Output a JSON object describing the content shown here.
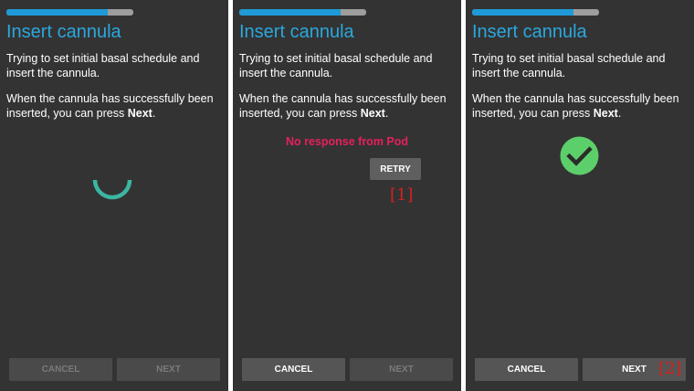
{
  "panels": [
    {
      "progress": 0.8,
      "title": "Insert cannula",
      "description": "Trying to set initial basal schedule and insert the cannula.",
      "hint_prefix": "When the cannula has successfully been inserted, you can press ",
      "hint_bold": "Next",
      "hint_suffix": ".",
      "status_icon": "loading-spinner",
      "cancel_label": "CANCEL",
      "next_label": "NEXT"
    },
    {
      "progress": 0.8,
      "title": "Insert cannula",
      "description": "Trying to set initial basal schedule and insert the cannula.",
      "hint_prefix": "When the cannula has successfully been inserted, you can press ",
      "hint_bold": "Next",
      "hint_suffix": ".",
      "error_text": "No response from Pod",
      "retry_label": "RETRY",
      "marker": "[1]",
      "cancel_label": "CANCEL",
      "next_label": "NEXT"
    },
    {
      "progress": 0.8,
      "title": "Insert cannula",
      "description": "Trying to set initial basal schedule and insert the cannula.",
      "hint_prefix": "When the cannula has successfully been inserted, you can press ",
      "hint_bold": "Next",
      "hint_suffix": ".",
      "status_icon": "check-circle",
      "marker": "[2]",
      "cancel_label": "CANCEL",
      "next_label": "NEXT"
    }
  ],
  "colors": {
    "accent": "#2aa8de",
    "error": "#e5205c",
    "success": "#5ccf6b",
    "spinner": "#3bb6a1",
    "marker": "#d62020"
  }
}
